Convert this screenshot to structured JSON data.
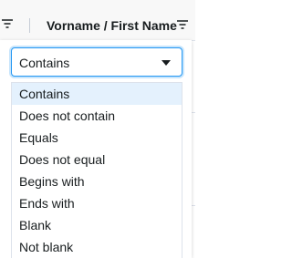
{
  "header": {
    "column_title": "Vorname / First Name"
  },
  "filter": {
    "selected_value": "Contains",
    "options": [
      "Contains",
      "Does not contain",
      "Equals",
      "Does not equal",
      "Begins with",
      "Ends with",
      "Blank",
      "Not blank"
    ],
    "highlighted_index": 0
  },
  "icons": {
    "previous_column_filter": "filter-icon",
    "column_filter": "filter-icon",
    "dropdown": "caret-down-icon"
  },
  "colors": {
    "accent": "#2196f3",
    "selected_option_bg": "#e4f1fd",
    "header_bg": "#f8f8f8",
    "border": "#dde2eb"
  }
}
